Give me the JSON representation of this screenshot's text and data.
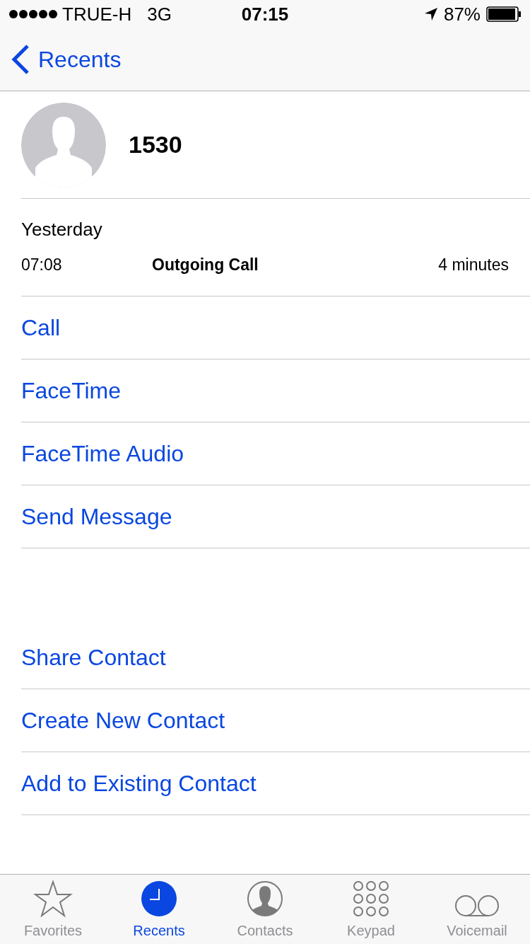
{
  "status_bar": {
    "carrier": "TRUE-H",
    "network": "3G",
    "time": "07:15",
    "battery": "87%"
  },
  "nav": {
    "back": "Recents"
  },
  "contact": {
    "name": "1530"
  },
  "call_log": {
    "date": "Yesterday",
    "entries": [
      {
        "time": "07:08",
        "type": "Outgoing Call",
        "duration": "4 minutes"
      }
    ]
  },
  "actions": [
    "Call",
    "FaceTime",
    "FaceTime Audio",
    "Send Message"
  ],
  "contact_actions": [
    "Share Contact",
    "Create New Contact",
    "Add to Existing Contact"
  ],
  "tab_bar": [
    {
      "kind": "favorites",
      "label": "Favorites",
      "selected": false
    },
    {
      "kind": "recents",
      "label": "Recents",
      "selected": true
    },
    {
      "kind": "contacts",
      "label": "Contacts",
      "selected": false
    },
    {
      "kind": "keypad",
      "label": "Keypad",
      "selected": false
    },
    {
      "kind": "voicemail",
      "label": "Voicemail",
      "selected": false
    }
  ]
}
